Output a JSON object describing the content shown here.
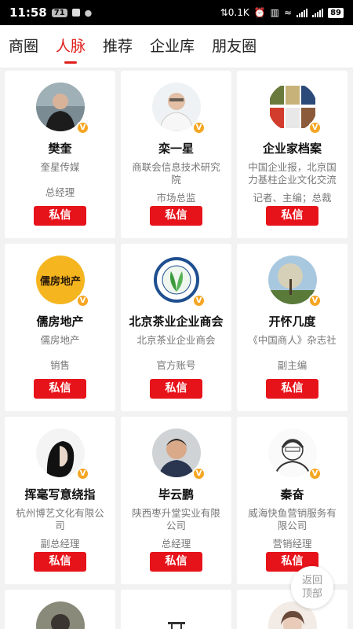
{
  "status_bar": {
    "time": "11:58",
    "badge": "71",
    "speed": "0.1K",
    "battery": "89"
  },
  "tabs": [
    "商圈",
    "人脉",
    "推荐",
    "企业库",
    "朋友圈"
  ],
  "active_tab": 1,
  "badge_letter": "V",
  "message_label": "私信",
  "cards": [
    {
      "name": "樊奎",
      "company": "奎星传媒",
      "title": "总经理",
      "avatar": "person-photo-avatar"
    },
    {
      "name": "栾一星",
      "company": "商联会信息技术研究院",
      "title": "市场总监",
      "avatar": "person-photo-avatar"
    },
    {
      "name": "企业家档案",
      "company": "中国企业报，北京国力基柱企业文化交流",
      "title": "记者、主编；总裁",
      "avatar": "magazine-collage-avatar"
    },
    {
      "name": "儒房地产",
      "company": "儒房地产",
      "title": "销售",
      "avatar": "logo-avatar",
      "logo_text": "儒房地产"
    },
    {
      "name": "北京茶业企业商会",
      "company": "北京茶业企业商会",
      "title": "官方账号",
      "avatar": "tea-leaf-emblem-avatar"
    },
    {
      "name": "开怀几度",
      "company": "《中国商人》杂志社",
      "title": "副主编",
      "avatar": "tree-photo-avatar"
    },
    {
      "name": "挥毫写意绕指",
      "company": "杭州博艺文化有限公司",
      "title": "副总经理",
      "avatar": "person-photo-avatar"
    },
    {
      "name": "毕云鹏",
      "company": "陕西枣升堂实业有限公司",
      "title": "总经理",
      "avatar": "person-photo-avatar"
    },
    {
      "name": "秦奋",
      "company": "威海快鱼营销服务有限公司",
      "title": "营销经理",
      "avatar": "person-sketch-avatar"
    }
  ],
  "back_to_top": {
    "line1": "返回",
    "line2": "顶部"
  }
}
